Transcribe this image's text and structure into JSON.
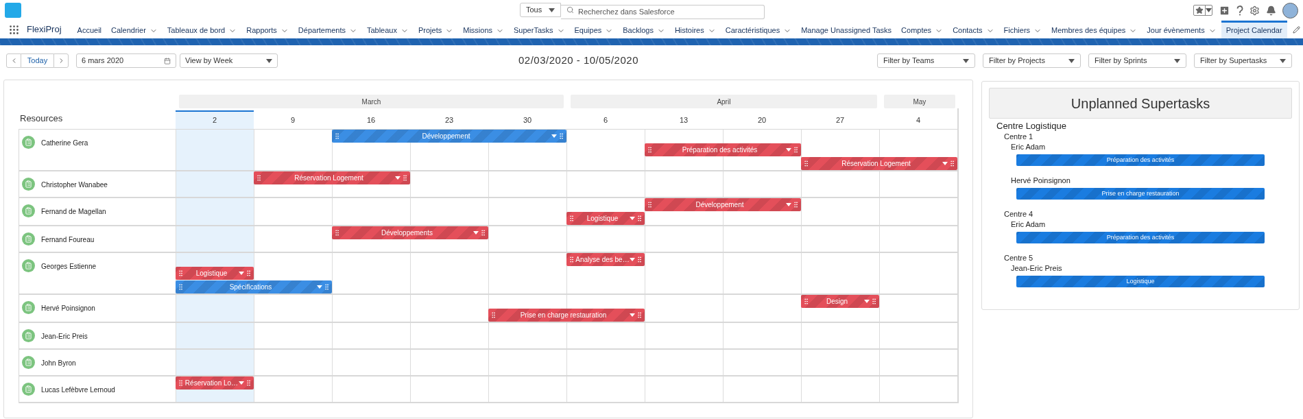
{
  "header": {
    "search_scope": "Tous",
    "search": {
      "placeholder": "Recherchez dans Salesforce"
    }
  },
  "nav": {
    "app_name": "FlexiProj",
    "items": [
      {
        "label": "Accueil",
        "has_menu": false,
        "selected": false
      },
      {
        "label": "Calendrier",
        "has_menu": true,
        "selected": false
      },
      {
        "label": "Tableaux de bord",
        "has_menu": true,
        "selected": false
      },
      {
        "label": "Rapports",
        "has_menu": true,
        "selected": false
      },
      {
        "label": "Départements",
        "has_menu": true,
        "selected": false
      },
      {
        "label": "Tableaux",
        "has_menu": true,
        "selected": false
      },
      {
        "label": "Projets",
        "has_menu": true,
        "selected": false
      },
      {
        "label": "Missions",
        "has_menu": true,
        "selected": false
      },
      {
        "label": "SuperTasks",
        "has_menu": true,
        "selected": false
      },
      {
        "label": "Equipes",
        "has_menu": true,
        "selected": false
      },
      {
        "label": "Backlogs",
        "has_menu": true,
        "selected": false
      },
      {
        "label": "Histoires",
        "has_menu": true,
        "selected": false
      },
      {
        "label": "Caractéristiques",
        "has_menu": true,
        "selected": false
      },
      {
        "label": "Manage Unassigned Tasks",
        "has_menu": false,
        "selected": false
      },
      {
        "label": "Comptes",
        "has_menu": true,
        "selected": false
      },
      {
        "label": "Contacts",
        "has_menu": true,
        "selected": false
      },
      {
        "label": "Fichiers",
        "has_menu": true,
        "selected": false
      },
      {
        "label": "Membres des équipes",
        "has_menu": true,
        "selected": false
      },
      {
        "label": "Jour évènements",
        "has_menu": true,
        "selected": false
      },
      {
        "label": "Project Calendar",
        "has_menu": false,
        "selected": true
      }
    ]
  },
  "toolbar": {
    "today": "Today",
    "date": "6 mars 2020",
    "view": "View by Week",
    "range": "02/03/2020 - 10/05/2020",
    "filters": [
      "Filter by Teams",
      "Filter by Projects",
      "Filter by Sprints",
      "Filter by Supertasks"
    ]
  },
  "calendar": {
    "resources_label": "Resources",
    "months": [
      {
        "label": "March",
        "weeks": [
          {
            "label": "2",
            "selected": true
          },
          {
            "label": "9",
            "selected": false
          },
          {
            "label": "16",
            "selected": false
          },
          {
            "label": "23",
            "selected": false
          },
          {
            "label": "30",
            "selected": false
          }
        ]
      },
      {
        "label": "April",
        "weeks": [
          {
            "label": "6",
            "selected": false
          },
          {
            "label": "13",
            "selected": false
          },
          {
            "label": "20",
            "selected": false
          },
          {
            "label": "27",
            "selected": false
          }
        ]
      },
      {
        "label": "May",
        "weeks": [
          {
            "label": "4",
            "selected": false
          }
        ]
      }
    ],
    "resources": [
      {
        "name": "Catherine Gera",
        "lanes": [
          [
            {
              "kind": "gap"
            },
            {
              "kind": "gap"
            },
            {
              "kind": "start",
              "title": "Développement",
              "color": "#3b8ee4"
            },
            {
              "kind": "cont"
            },
            {
              "kind": "cont"
            }
          ],
          [
            {
              "kind": "gap"
            },
            {
              "kind": "gap"
            },
            {
              "kind": "gap"
            },
            {
              "kind": "gap"
            },
            {
              "kind": "gap"
            },
            {
              "kind": "gap"
            },
            {
              "kind": "start",
              "title": "Préparation des activités",
              "color": "#e44f5a"
            },
            {
              "kind": "cont"
            }
          ],
          [
            {
              "kind": "gap"
            },
            {
              "kind": "gap"
            },
            {
              "kind": "gap"
            },
            {
              "kind": "gap"
            },
            {
              "kind": "gap"
            },
            {
              "kind": "gap"
            },
            {
              "kind": "gap"
            },
            {
              "kind": "gap"
            },
            {
              "kind": "start",
              "title": "Réservation Logement",
              "color": "#e44f5a"
            },
            {
              "kind": "cont"
            }
          ]
        ]
      },
      {
        "name": "Christopher Wanabee",
        "lanes": [
          [
            {
              "kind": "gap"
            },
            {
              "kind": "start",
              "title": "Réservation Logement",
              "color": "#e44f5a"
            },
            {
              "kind": "cont"
            }
          ]
        ]
      },
      {
        "name": "Fernand de Magellan",
        "lanes": [
          [
            {
              "kind": "gap"
            },
            {
              "kind": "gap"
            },
            {
              "kind": "gap"
            },
            {
              "kind": "gap"
            },
            {
              "kind": "gap"
            },
            {
              "kind": "gap"
            },
            {
              "kind": "start",
              "title": "Développement",
              "color": "#e44f5a"
            },
            {
              "kind": "cont"
            }
          ],
          [
            {
              "kind": "gap"
            },
            {
              "kind": "gap"
            },
            {
              "kind": "gap"
            },
            {
              "kind": "gap"
            },
            {
              "kind": "gap"
            },
            {
              "kind": "start",
              "title": "Logistique",
              "color": "#e44f5a"
            }
          ]
        ]
      },
      {
        "name": "Fernand Foureau",
        "lanes": [
          [
            {
              "kind": "gap"
            },
            {
              "kind": "gap"
            },
            {
              "kind": "start",
              "title": "Développements",
              "color": "#e44f5a"
            },
            {
              "kind": "cont"
            }
          ]
        ]
      },
      {
        "name": "Georges Estienne",
        "lanes": [
          [
            {
              "kind": "gap"
            },
            {
              "kind": "gap"
            },
            {
              "kind": "gap"
            },
            {
              "kind": "gap"
            },
            {
              "kind": "gap"
            },
            {
              "kind": "start",
              "title": "Analyse des be…",
              "color": "#e44f5a"
            }
          ],
          [
            {
              "kind": "start",
              "title": "Logistique",
              "color": "#e44f5a"
            }
          ],
          [
            {
              "kind": "start",
              "title": "Spécifications",
              "color": "#3b8ee4"
            },
            {
              "kind": "cont"
            }
          ]
        ]
      },
      {
        "name": "Hervé Poinsignon",
        "lanes": [
          [
            {
              "kind": "gap"
            },
            {
              "kind": "gap"
            },
            {
              "kind": "gap"
            },
            {
              "kind": "gap"
            },
            {
              "kind": "gap"
            },
            {
              "kind": "gap"
            },
            {
              "kind": "gap"
            },
            {
              "kind": "gap"
            },
            {
              "kind": "start",
              "title": "Design",
              "color": "#e44f5a"
            }
          ],
          [
            {
              "kind": "gap"
            },
            {
              "kind": "gap"
            },
            {
              "kind": "gap"
            },
            {
              "kind": "gap"
            },
            {
              "kind": "start",
              "title": "Prise en charge restauration",
              "color": "#e44f5a"
            },
            {
              "kind": "cont"
            }
          ]
        ]
      },
      {
        "name": "Jean-Eric Preis"
      },
      {
        "name": "John Byron"
      },
      {
        "name": "Lucas Lefèbvre Lernoud",
        "lanes": [
          [
            {
              "kind": "start",
              "title": "Réservation Lo…",
              "color": "#e44f5a"
            }
          ]
        ]
      }
    ]
  },
  "unplanned": {
    "title": "Unplanned Supertasks",
    "groups": [
      {
        "name": "Centre Logistique",
        "children": [
          {
            "name": "Centre 1",
            "children": [
              {
                "name": "Eric Adam",
                "tasks": [
                  "Préparation des activités"
                ]
              },
              {
                "name": "Hervé Poinsignon",
                "tasks": [
                  "Prise en charge restauration"
                ]
              }
            ]
          },
          {
            "name": "Centre 4",
            "children": [
              {
                "name": "Eric Adam",
                "tasks": [
                  "Préparation des activités"
                ]
              }
            ]
          },
          {
            "name": "Centre 5",
            "children": [
              {
                "name": "Jean-Eric Preis",
                "tasks": [
                  "Logistique"
                ]
              }
            ]
          }
        ]
      }
    ]
  }
}
